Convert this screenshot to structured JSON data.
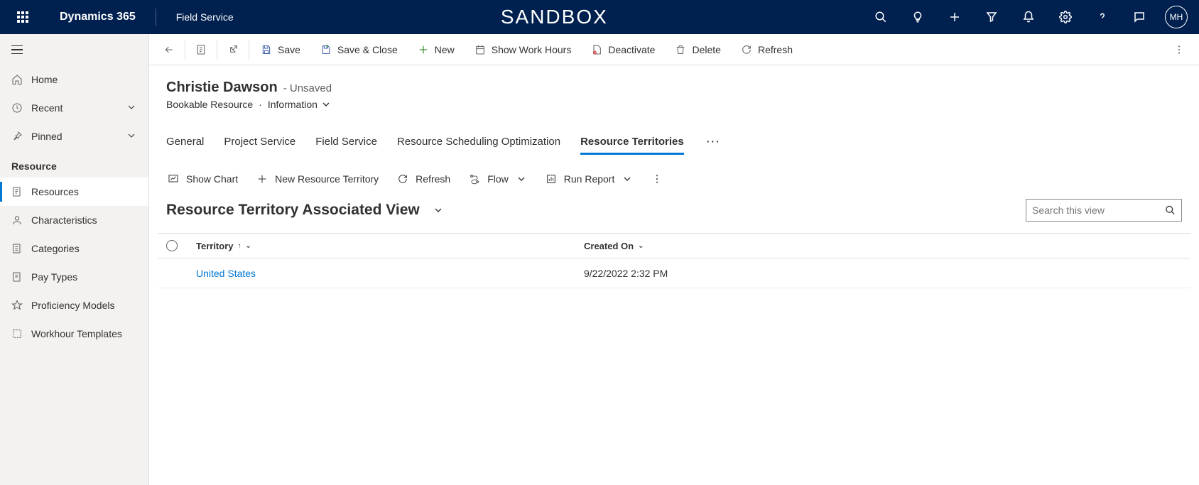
{
  "topnav": {
    "brand": "Dynamics 365",
    "app": "Field Service",
    "sandbox": "SANDBOX",
    "avatar": "MH"
  },
  "sidebar": {
    "home": "Home",
    "recent": "Recent",
    "pinned": "Pinned",
    "group": "Resource",
    "items": {
      "resources": "Resources",
      "characteristics": "Characteristics",
      "categories": "Categories",
      "paytypes": "Pay Types",
      "proficiency": "Proficiency Models",
      "workhour": "Workhour Templates"
    }
  },
  "cmdbar": {
    "save": "Save",
    "save_close": "Save & Close",
    "new": "New",
    "show_work_hours": "Show Work Hours",
    "deactivate": "Deactivate",
    "delete": "Delete",
    "refresh": "Refresh"
  },
  "record": {
    "title": "Christie Dawson",
    "status": "- Unsaved",
    "entity": "Bookable Resource",
    "form": "Information"
  },
  "tabs": {
    "general": "General",
    "project_service": "Project Service",
    "field_service": "Field Service",
    "rso": "Resource Scheduling Optimization",
    "territories": "Resource Territories"
  },
  "subgrid": {
    "show_chart": "Show Chart",
    "new_territory": "New Resource Territory",
    "refresh": "Refresh",
    "flow": "Flow",
    "run_report": "Run Report"
  },
  "view": {
    "title": "Resource Territory Associated View",
    "search_placeholder": "Search this view"
  },
  "grid": {
    "col_territory": "Territory",
    "col_created": "Created On",
    "rows": [
      {
        "territory": "United States",
        "created": "9/22/2022 2:32 PM"
      }
    ]
  }
}
